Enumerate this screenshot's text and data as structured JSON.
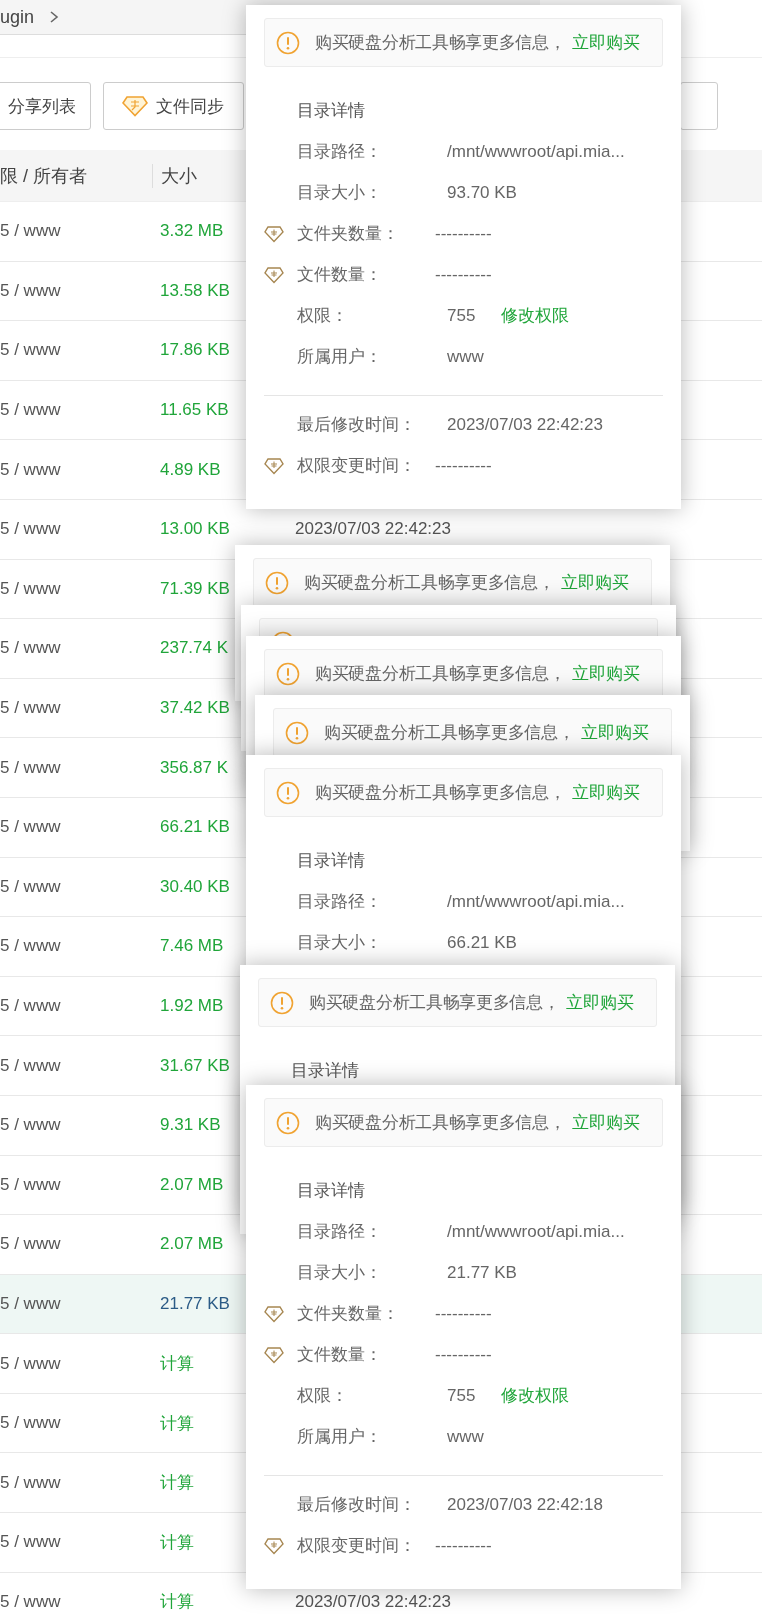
{
  "breadcrumb": {
    "segment": "ugin"
  },
  "toolbar": {
    "buttons": [
      {
        "label": "分享列表",
        "kind": "plain"
      },
      {
        "label": "文件同步",
        "kind": "premium"
      },
      {
        "kind": "plain"
      }
    ]
  },
  "table": {
    "columns": [
      "限 / 所有者",
      "大小"
    ],
    "rows": [
      {
        "owner": "5 / www",
        "size": "3.32 MB",
        "selected": false
      },
      {
        "owner": "5 / www",
        "size": "13.58 KB",
        "selected": false
      },
      {
        "owner": "5 / www",
        "size": "17.86 KB",
        "selected": false
      },
      {
        "owner": "5 / www",
        "size": "11.65 KB",
        "selected": false
      },
      {
        "owner": "5 / www",
        "size": "4.89 KB",
        "selected": false
      },
      {
        "owner": "5 / www",
        "size": "13.00 KB",
        "selected": false,
        "modified": "2023/07/03 22:42:23"
      },
      {
        "owner": "5 / www",
        "size": "71.39 KB",
        "selected": false
      },
      {
        "owner": "5 / www",
        "size": "237.74 K",
        "selected": false
      },
      {
        "owner": "5 / www",
        "size": "37.42 KB",
        "selected": false
      },
      {
        "owner": "5 / www",
        "size": "356.87 K",
        "selected": false
      },
      {
        "owner": "5 / www",
        "size": "66.21 KB",
        "selected": false
      },
      {
        "owner": "5 / www",
        "size": "30.40 KB",
        "selected": false
      },
      {
        "owner": "5 / www",
        "size": "7.46 MB",
        "selected": false
      },
      {
        "owner": "5 / www",
        "size": "1.92 MB",
        "selected": false
      },
      {
        "owner": "5 / www",
        "size": "31.67 KB",
        "selected": false
      },
      {
        "owner": "5 / www",
        "size": "9.31 KB",
        "selected": false
      },
      {
        "owner": "5 / www",
        "size": "2.07 MB",
        "selected": false
      },
      {
        "owner": "5 / www",
        "size": "2.07 MB",
        "selected": false
      },
      {
        "owner": "5 / www",
        "size": "21.77 KB",
        "selected": true
      },
      {
        "owner": "5 / www",
        "size": "计算",
        "selected": false
      },
      {
        "owner": "5 / www",
        "size": "计算",
        "selected": false
      },
      {
        "owner": "5 / www",
        "size": "计算",
        "selected": false
      },
      {
        "owner": "5 / www",
        "size": "计算",
        "selected": false
      },
      {
        "owner": "5 / www",
        "size": "计算",
        "selected": false,
        "modified": "2023/07/03 22:42:23"
      }
    ]
  },
  "popovers": [
    {
      "notice": {
        "text": "购买硬盘分析工具畅享更多信息，",
        "link": "立即购买"
      },
      "title": "目录详情",
      "rows": [
        {
          "label": "目录路径：",
          "value": "/mnt/wwwroot/api.mia...",
          "premium": false
        },
        {
          "label": "目录大小：",
          "value": "93.70 KB",
          "premium": false
        },
        {
          "label": "文件夹数量：",
          "value": "----------",
          "premium": true
        },
        {
          "label": "文件数量：",
          "value": "----------",
          "premium": true
        },
        {
          "label": "权限：",
          "value": "755",
          "action": "修改权限",
          "premium": false
        },
        {
          "label": "所属用户：",
          "value": "www",
          "premium": false
        }
      ],
      "footer_rows": [
        {
          "label": "最后修改时间：",
          "value": "2023/07/03 22:42:23",
          "premium": false
        },
        {
          "label": "权限变更时间：",
          "value": "----------",
          "premium": true
        }
      ]
    },
    {
      "notice": {
        "text": "购买硬盘分析工具畅享更多信息，",
        "link": "立即购买"
      }
    },
    {
      "kind": "covered"
    },
    {
      "notice": {
        "text": "购买硬盘分析工具畅享更多信息，",
        "link": "立即购买"
      }
    },
    {
      "notice": {
        "text": "购买硬盘分析工具畅享更多信息，",
        "link": "立即购买"
      }
    },
    {
      "notice": {
        "text": "购买硬盘分析工具畅享更多信息，",
        "link": "立即购买"
      },
      "title": "目录详情",
      "rows": [
        {
          "label": "目录路径：",
          "value": "/mnt/wwwroot/api.mia...",
          "premium": false
        },
        {
          "label": "目录大小：",
          "value": "66.21 KB",
          "premium": false
        }
      ]
    },
    {
      "notice": {
        "text": "购买硬盘分析工具畅享更多信息，",
        "link": "立即购买"
      },
      "title": "目录详情"
    },
    {
      "notice": {
        "text": "购买硬盘分析工具畅享更多信息，",
        "link": "立即购买"
      },
      "title": "目录详情",
      "rows": [
        {
          "label": "目录路径：",
          "value": "/mnt/wwwroot/api.mia...",
          "premium": false
        },
        {
          "label": "目录大小：",
          "value": "21.77 KB",
          "premium": false
        },
        {
          "label": "文件夹数量：",
          "value": "----------",
          "premium": true
        },
        {
          "label": "文件数量：",
          "value": "----------",
          "premium": true
        },
        {
          "label": "权限：",
          "value": "755",
          "action": "修改权限",
          "premium": false
        },
        {
          "label": "所属用户：",
          "value": "www",
          "premium": false
        }
      ],
      "footer_rows": [
        {
          "label": "最后修改时间：",
          "value": "2023/07/03 22:42:18",
          "premium": false
        },
        {
          "label": "权限变更时间：",
          "value": "----------",
          "premium": true
        }
      ]
    }
  ]
}
